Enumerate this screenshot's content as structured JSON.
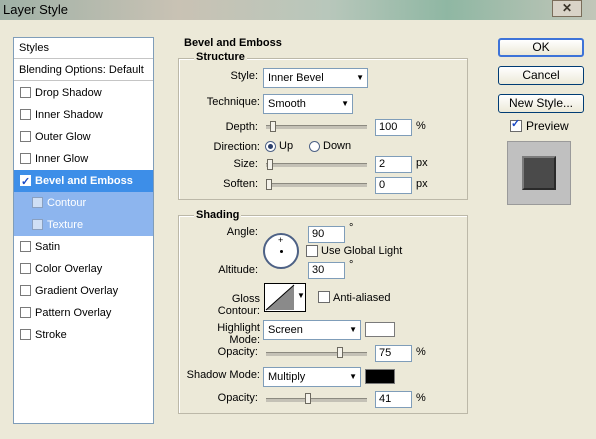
{
  "window": {
    "title": "Layer Style",
    "close_glyph": "✕"
  },
  "sidebar": {
    "header": "Styles",
    "blending": "Blending Options: Default",
    "items": [
      {
        "label": "Drop Shadow",
        "checked": false
      },
      {
        "label": "Inner Shadow",
        "checked": false
      },
      {
        "label": "Outer Glow",
        "checked": false
      },
      {
        "label": "Inner Glow",
        "checked": false
      },
      {
        "label": "Bevel and Emboss",
        "checked": true,
        "selected": true
      },
      {
        "label": "Contour",
        "checked": false,
        "sub": true
      },
      {
        "label": "Texture",
        "checked": false,
        "sub": true
      },
      {
        "label": "Satin",
        "checked": false
      },
      {
        "label": "Color Overlay",
        "checked": false
      },
      {
        "label": "Gradient Overlay",
        "checked": false
      },
      {
        "label": "Pattern Overlay",
        "checked": false
      },
      {
        "label": "Stroke",
        "checked": false
      }
    ]
  },
  "bevel": {
    "title": "Bevel and Emboss",
    "structure": {
      "title": "Structure",
      "style_label": "Style:",
      "style_value": "Inner Bevel",
      "technique_label": "Technique:",
      "technique_value": "Smooth",
      "depth_label": "Depth:",
      "depth_value": "100",
      "depth_unit": "%",
      "depth_level": 0.04,
      "direction_label": "Direction:",
      "direction_up": "Up",
      "direction_down": "Down",
      "size_label": "Size:",
      "size_value": "2",
      "size_unit": "px",
      "size_level": 0.01,
      "soften_label": "Soften:",
      "soften_value": "0",
      "soften_unit": "px",
      "soften_level": 0.0
    },
    "shading": {
      "title": "Shading",
      "angle_label": "Angle:",
      "angle_value": "90",
      "degree": "°",
      "use_global_light": "Use Global Light",
      "altitude_label": "Altitude:",
      "altitude_value": "30",
      "gloss_label": "Gloss Contour:",
      "anti_aliased": "Anti-aliased",
      "highlight_label": "Highlight Mode:",
      "highlight_value": "Screen",
      "highlight_color": "#ffffff",
      "opacity_label": "Opacity:",
      "highlight_opacity": "75",
      "highlight_level": 0.75,
      "shadow_label": "Shadow Mode:",
      "shadow_value": "Multiply",
      "shadow_color": "#000000",
      "shadow_opacity": "41",
      "shadow_level": 0.41,
      "percent": "%"
    }
  },
  "buttons": {
    "ok": "OK",
    "cancel": "Cancel",
    "new_style": "New Style...",
    "preview": "Preview"
  }
}
